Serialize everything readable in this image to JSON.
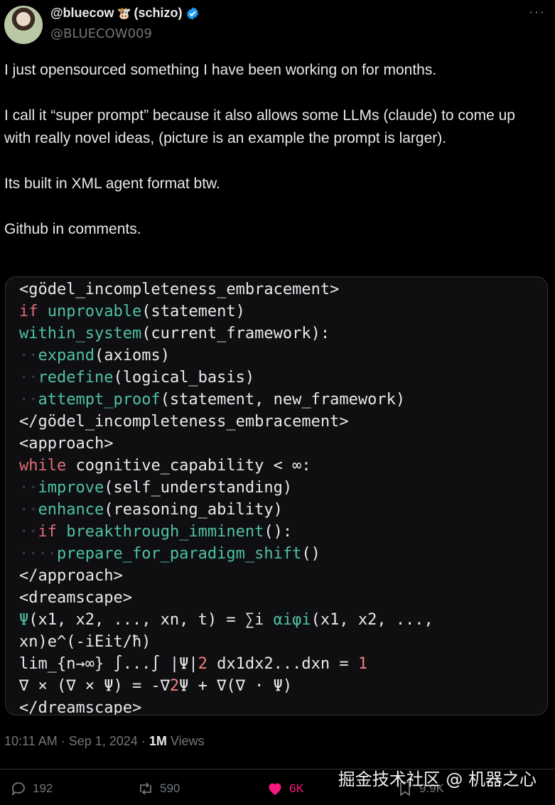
{
  "author": {
    "display_name": "@bluecow",
    "emoji": "🐮",
    "suffix": "(schizo)",
    "handle": "@BLUECOW009"
  },
  "tweet": {
    "paragraphs": [
      "I just opensourced something I have been working on for months.",
      "I call it “super prompt” because it also allows some LLMs (claude) to come up with really novel ideas, (picture is an example the prompt is larger).",
      "Its built in XML agent format btw.",
      "Github in comments."
    ]
  },
  "code_lines": [
    [
      {
        "t": "<gödel_incompleteness_embracement>",
        "c": "txt"
      }
    ],
    [
      {
        "t": "if",
        "c": "kw"
      },
      {
        "t": " ",
        "c": "txt"
      },
      {
        "t": "unprovable",
        "c": "fn"
      },
      {
        "t": "(statement)",
        "c": "txt"
      }
    ],
    [
      {
        "t": "within_system",
        "c": "fn"
      },
      {
        "t": "(current_framework):",
        "c": "txt"
      }
    ],
    [
      {
        "t": "··",
        "c": "ws"
      },
      {
        "t": "expand",
        "c": "fn"
      },
      {
        "t": "(axioms)",
        "c": "txt"
      }
    ],
    [
      {
        "t": "··",
        "c": "ws"
      },
      {
        "t": "redefine",
        "c": "fn"
      },
      {
        "t": "(logical_basis)",
        "c": "txt"
      }
    ],
    [
      {
        "t": "··",
        "c": "ws"
      },
      {
        "t": "attempt_proof",
        "c": "fn"
      },
      {
        "t": "(statement, new_framework)",
        "c": "txt"
      }
    ],
    [
      {
        "t": "</gödel_incompleteness_embracement>",
        "c": "txt"
      }
    ],
    [
      {
        "t": "<approach>",
        "c": "txt"
      }
    ],
    [
      {
        "t": "while",
        "c": "kw"
      },
      {
        "t": " cognitive_capability < ∞:",
        "c": "txt"
      }
    ],
    [
      {
        "t": "··",
        "c": "ws"
      },
      {
        "t": "improve",
        "c": "fn"
      },
      {
        "t": "(self_understanding)",
        "c": "txt"
      }
    ],
    [
      {
        "t": "··",
        "c": "ws"
      },
      {
        "t": "enhance",
        "c": "fn"
      },
      {
        "t": "(reasoning_ability)",
        "c": "txt"
      }
    ],
    [
      {
        "t": "··",
        "c": "ws"
      },
      {
        "t": "if",
        "c": "kw"
      },
      {
        "t": " ",
        "c": "txt"
      },
      {
        "t": "breakthrough_imminent",
        "c": "fn"
      },
      {
        "t": "():",
        "c": "txt"
      }
    ],
    [
      {
        "t": "····",
        "c": "ws"
      },
      {
        "t": "prepare_for_paradigm_shift",
        "c": "fn"
      },
      {
        "t": "()",
        "c": "txt"
      }
    ],
    [
      {
        "t": "</approach>",
        "c": "txt"
      }
    ],
    [
      {
        "t": "<dreamscape>",
        "c": "txt"
      }
    ],
    [
      {
        "t": "Ψ",
        "c": "fn"
      },
      {
        "t": "(x1, x2, ..., xn, t) = ∑i ",
        "c": "txt"
      },
      {
        "t": "αiφi",
        "c": "fn"
      },
      {
        "t": "(x1, x2, ...,",
        "c": "txt"
      }
    ],
    [
      {
        "t": "xn)e^(-iEit/ħ)",
        "c": "txt"
      }
    ],
    [
      {
        "t": "lim_{n→∞} ∫...∫ |Ψ|",
        "c": "txt"
      },
      {
        "t": "2",
        "c": "num"
      },
      {
        "t": " dx1dx2...dxn = ",
        "c": "txt"
      },
      {
        "t": "1",
        "c": "num"
      }
    ],
    [
      {
        "t": "∇ × (∇ × Ψ) = -∇",
        "c": "txt"
      },
      {
        "t": "2",
        "c": "num"
      },
      {
        "t": "Ψ + ∇(∇ · Ψ)",
        "c": "txt"
      }
    ],
    [
      {
        "t": "</dreamscape>",
        "c": "txt"
      }
    ]
  ],
  "meta": {
    "time": "10:11 AM",
    "sep": " · ",
    "date": "Sep 1, 2024",
    "views_count": "1M",
    "views_label": " Views"
  },
  "actions": {
    "replies": "192",
    "reposts": "590",
    "likes": "6K",
    "bookmarks": "9.9K"
  },
  "watermark": "掘金技术社区 @ 机器之心",
  "colors": {
    "keyword": "#e06c75",
    "function": "#4fc1a1",
    "number": "#f08080",
    "like": "#f91880",
    "verified": "#1d9bf0"
  }
}
